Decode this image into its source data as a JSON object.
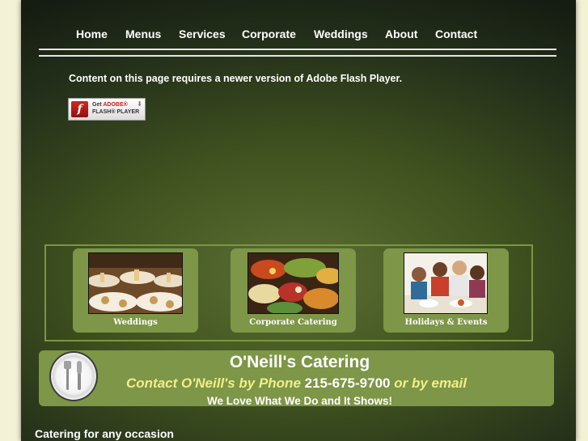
{
  "nav": {
    "items": [
      {
        "label": "Home"
      },
      {
        "label": "Menus"
      },
      {
        "label": "Services"
      },
      {
        "label": "Corporate"
      },
      {
        "label": "Weddings"
      },
      {
        "label": "About"
      },
      {
        "label": "Contact"
      }
    ]
  },
  "flash": {
    "message": "Content on this page requires a newer version of Adobe Flash Player.",
    "badge_line1_prefix": "Get ",
    "badge_line1_brand": "ADOBE®",
    "badge_line2": "FLASH® PLAYER",
    "badge_logo_letter": "f"
  },
  "gallery": {
    "cards": [
      {
        "label": "Weddings",
        "icon": "wedding-banquet-photo"
      },
      {
        "label": "Corporate Catering",
        "icon": "buffet-food-photo"
      },
      {
        "label": "Holidays & Events",
        "icon": "family-dinner-photo"
      }
    ]
  },
  "banner": {
    "title": "O'Neill's Catering",
    "contact_prefix": "Contact O'Neill's by Phone ",
    "phone": "215-675-9700",
    "contact_suffix": " or by email",
    "tagline": "We Love What We Do and It Shows!",
    "icon": "plate-fork-knife-icon"
  },
  "footer": {
    "text": "Catering for any occasion"
  },
  "colors": {
    "page_bg": "#f3f1d6",
    "panel_green": "#7d9647",
    "contact_yellow": "#f2ee8a"
  }
}
